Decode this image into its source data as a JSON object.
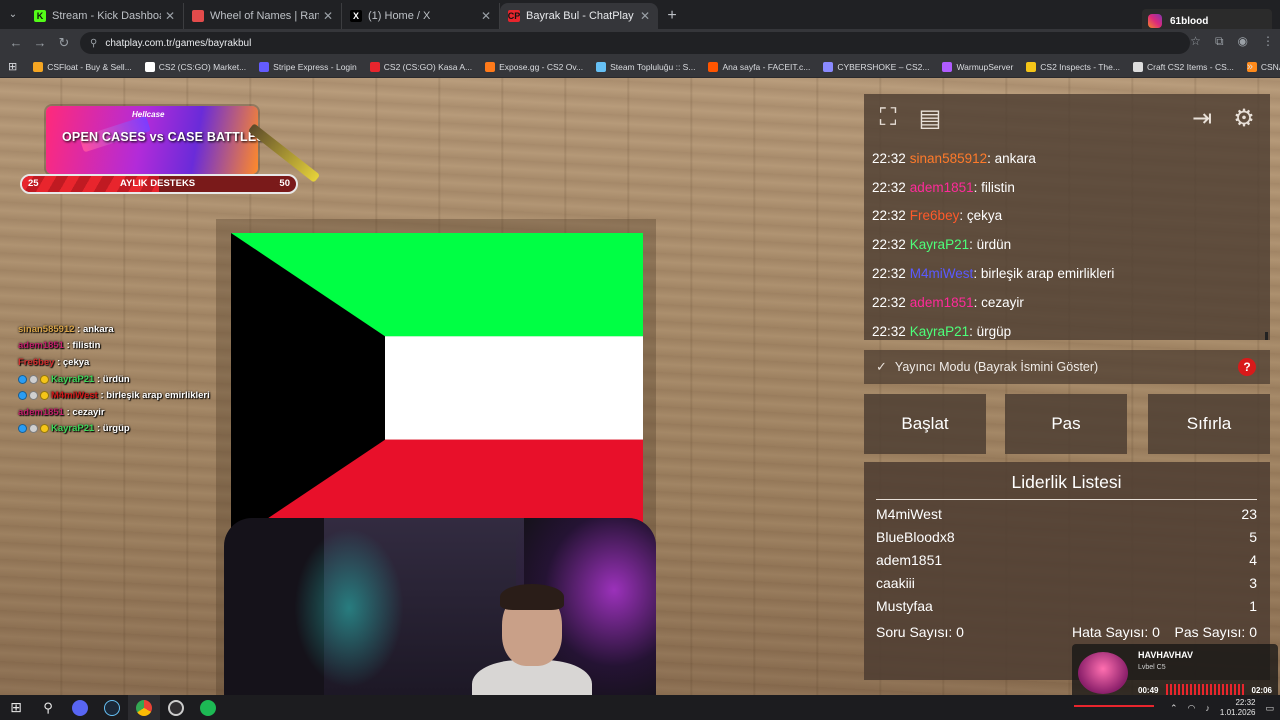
{
  "browser": {
    "tabs": [
      {
        "title": "Stream - Kick Dashboard",
        "fav": "K",
        "fav_color": "#53fc18",
        "active": false
      },
      {
        "title": "Wheel of Names | Random nam",
        "fav": "",
        "fav_color": "#e34b4b",
        "active": false
      },
      {
        "title": "(1) Home / X",
        "fav": "X",
        "fav_color": "#000000",
        "active": false
      },
      {
        "title": "Bayrak Bul - ChatPlay",
        "fav": "CP",
        "fav_color": "#e8252d",
        "active": true
      }
    ],
    "url": "chatplay.com.tr/games/bayrakbul",
    "instagram_user": "61blood",
    "bookmarks": [
      {
        "label": "CSFloat - Buy & Sell...",
        "color": "#f5a623"
      },
      {
        "label": "CS2 (CS:GO) Market...",
        "color": "#ffffff"
      },
      {
        "label": "Stripe Express - Login",
        "color": "#635bff"
      },
      {
        "label": "CS2 (CS:GO) Kasa A...",
        "color": "#e8252d"
      },
      {
        "label": "Expose.gg - CS2 Ov...",
        "color": "#ff7a1a"
      },
      {
        "label": "Steam Topluluğu :: S...",
        "color": "#66c0f4"
      },
      {
        "label": "Ana sayfa - FACEIT.c...",
        "color": "#ff5500"
      },
      {
        "label": "CYBERSHOKE – CS2...",
        "color": "#8a8aff"
      },
      {
        "label": "WarmupServer",
        "color": "#b05cff"
      },
      {
        "label": "CS2 Inspects - The...",
        "color": "#f5c518"
      },
      {
        "label": "Craft CS2 Items - CS...",
        "color": "#dddddd"
      },
      {
        "label": "CSNADES.gg - Cou...",
        "color": "#ff8a1a"
      }
    ]
  },
  "banner": {
    "brand": "Hellcase",
    "headline": "OPEN CASES vs CASE BATTLES",
    "progress_min": "25",
    "progress_label": "AYLIK DESTEKS",
    "progress_max": "50",
    "progress_fraction": 0.5
  },
  "overlay_chat": [
    {
      "user": "sinan585912",
      "msg": "ankara",
      "color": "#d8a44a",
      "badges": []
    },
    {
      "user": "adem1851",
      "msg": "filistin",
      "color": "#c0206a",
      "badges": []
    },
    {
      "user": "Fre6bey",
      "msg": "çekya",
      "color": "#d03030",
      "badges": []
    },
    {
      "user": "KayraP21",
      "msg": "ürdün",
      "color": "#3fd65a",
      "badges": [
        "#2a9df4",
        "#cfcfcf",
        "#f5c518"
      ]
    },
    {
      "user": "M4miWest",
      "msg": "birleşik arap emirlikleri",
      "color": "#d01818",
      "badges": [
        "#2a9df4",
        "#cfcfcf",
        "#f5c518"
      ]
    },
    {
      "user": "adem1851",
      "msg": "cezayir",
      "color": "#c0206a",
      "badges": []
    },
    {
      "user": "KayraP21",
      "msg": "ürgüp",
      "color": "#3fd65a",
      "badges": [
        "#2a9df4",
        "#cfcfcf",
        "#f5c518"
      ]
    }
  ],
  "flag": {
    "colors": {
      "green": "#00ff44",
      "white": "#ffffff",
      "red": "#e8102a",
      "black": "#000000"
    }
  },
  "chatplay": {
    "chat": [
      {
        "time": "22:32",
        "user": "sinan585912",
        "msg": "ankara",
        "color": "#ff7a2a"
      },
      {
        "time": "22:32",
        "user": "adem1851",
        "msg": "filistin",
        "color": "#ff2a9a"
      },
      {
        "time": "22:32",
        "user": "Fre6bey",
        "msg": "çekya",
        "color": "#ff5a2a"
      },
      {
        "time": "22:32",
        "user": "KayraP21",
        "msg": "ürdün",
        "color": "#4dff7a"
      },
      {
        "time": "22:32",
        "user": "M4miWest",
        "msg": "birleşik arap emirlikleri",
        "color": "#5a5aff"
      },
      {
        "time": "22:32",
        "user": "adem1851",
        "msg": "cezayir",
        "color": "#ff2a9a"
      },
      {
        "time": "22:32",
        "user": "KayraP21",
        "msg": "ürgüp",
        "color": "#4dff7a"
      }
    ],
    "streamer_mode_label": "Yayıncı Modu (Bayrak İsmini Göster)",
    "help": "?",
    "buttons": {
      "start": "Başlat",
      "pass": "Pas",
      "reset": "Sıfırla"
    },
    "leaderboard": {
      "title": "Liderlik Listesi",
      "rows": [
        {
          "name": "M4miWest",
          "score": "23"
        },
        {
          "name": "BlueBloodx8",
          "score": "5"
        },
        {
          "name": "adem1851",
          "score": "4"
        },
        {
          "name": "caakiii",
          "score": "3"
        },
        {
          "name": "Mustyfaa",
          "score": "1"
        }
      ],
      "questions": "Soru Sayısı: 0",
      "errors": "Hata Sayısı: 0",
      "passes": "Pas Sayısı: 0"
    }
  },
  "spotify": {
    "track": "HAVHAVHAV",
    "artist": "Lvbel C5",
    "elapsed": "00:49",
    "duration": "02:06"
  },
  "taskbar": {
    "time": "22:32",
    "date": "1.01.2026"
  }
}
